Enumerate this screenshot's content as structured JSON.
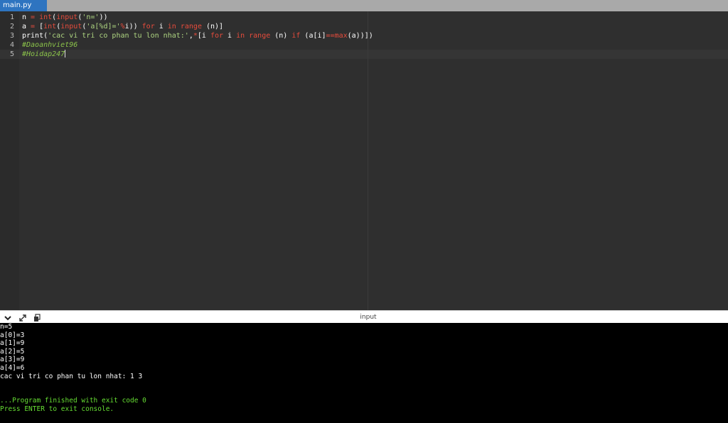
{
  "tab": {
    "label": "main.py"
  },
  "editor": {
    "lines": [
      {
        "number": "1",
        "tokens": [
          {
            "text": "n ",
            "cls": "t-default"
          },
          {
            "text": "=",
            "cls": "t-kw"
          },
          {
            "text": " ",
            "cls": "t-default"
          },
          {
            "text": "int",
            "cls": "t-kw"
          },
          {
            "text": "(",
            "cls": "t-default"
          },
          {
            "text": "input",
            "cls": "t-kw"
          },
          {
            "text": "(",
            "cls": "t-default"
          },
          {
            "text": "'n='",
            "cls": "t-str"
          },
          {
            "text": "))",
            "cls": "t-default"
          }
        ]
      },
      {
        "number": "2",
        "tokens": [
          {
            "text": "a ",
            "cls": "t-default"
          },
          {
            "text": "=",
            "cls": "t-kw"
          },
          {
            "text": " [",
            "cls": "t-default"
          },
          {
            "text": "int",
            "cls": "t-kw"
          },
          {
            "text": "(",
            "cls": "t-default"
          },
          {
            "text": "input",
            "cls": "t-kw"
          },
          {
            "text": "(",
            "cls": "t-default"
          },
          {
            "text": "'a[%d]='",
            "cls": "t-str"
          },
          {
            "text": "%",
            "cls": "t-kw"
          },
          {
            "text": "i)) ",
            "cls": "t-default"
          },
          {
            "text": "for",
            "cls": "t-kw"
          },
          {
            "text": " i ",
            "cls": "t-default"
          },
          {
            "text": "in",
            "cls": "t-kw"
          },
          {
            "text": " ",
            "cls": "t-default"
          },
          {
            "text": "range",
            "cls": "t-kw"
          },
          {
            "text": " (n)]",
            "cls": "t-default"
          }
        ]
      },
      {
        "number": "3",
        "tokens": [
          {
            "text": "print(",
            "cls": "t-default"
          },
          {
            "text": "'cac vi tri co phan tu lon nhat:'",
            "cls": "t-str"
          },
          {
            "text": ",",
            "cls": "t-default"
          },
          {
            "text": "*",
            "cls": "t-kw"
          },
          {
            "text": "[i ",
            "cls": "t-default"
          },
          {
            "text": "for",
            "cls": "t-kw"
          },
          {
            "text": " i ",
            "cls": "t-default"
          },
          {
            "text": "in",
            "cls": "t-kw"
          },
          {
            "text": " ",
            "cls": "t-default"
          },
          {
            "text": "range",
            "cls": "t-kw"
          },
          {
            "text": " (n) ",
            "cls": "t-default"
          },
          {
            "text": "if",
            "cls": "t-kw"
          },
          {
            "text": " (a[i]",
            "cls": "t-default"
          },
          {
            "text": "==",
            "cls": "t-kw"
          },
          {
            "text": "max",
            "cls": "t-kw"
          },
          {
            "text": "(a))])",
            "cls": "t-default"
          }
        ]
      },
      {
        "number": "4",
        "tokens": [
          {
            "text": "#Daoanhviet96",
            "cls": "t-comment"
          }
        ]
      },
      {
        "number": "5",
        "tokens": [
          {
            "text": "#Hoidap247",
            "cls": "t-comment"
          }
        ]
      }
    ]
  },
  "console": {
    "title": "input",
    "icons": [
      "chevron-down-icon",
      "expand-icon",
      "copy-icon"
    ],
    "lines": [
      {
        "text": "n=5",
        "color": "white"
      },
      {
        "text": "a[0]=3",
        "color": "white"
      },
      {
        "text": "a[1]=9",
        "color": "white"
      },
      {
        "text": "a[2]=5",
        "color": "white"
      },
      {
        "text": "a[3]=9",
        "color": "white"
      },
      {
        "text": "a[4]=6",
        "color": "white"
      },
      {
        "text": "cac vi tri co phan tu lon nhat: 1 3",
        "color": "white"
      },
      {
        "text": "",
        "color": "white"
      },
      {
        "text": "",
        "color": "white"
      },
      {
        "text": "...Program finished with exit code 0",
        "color": "green"
      },
      {
        "text": "Press ENTER to exit console.",
        "color": "green"
      }
    ]
  },
  "colors": {
    "tab_active": "#2e74c0",
    "keyword": "#e74c3c",
    "string": "#aed581",
    "comment": "#8bc34a",
    "console_green": "#66dd33"
  }
}
